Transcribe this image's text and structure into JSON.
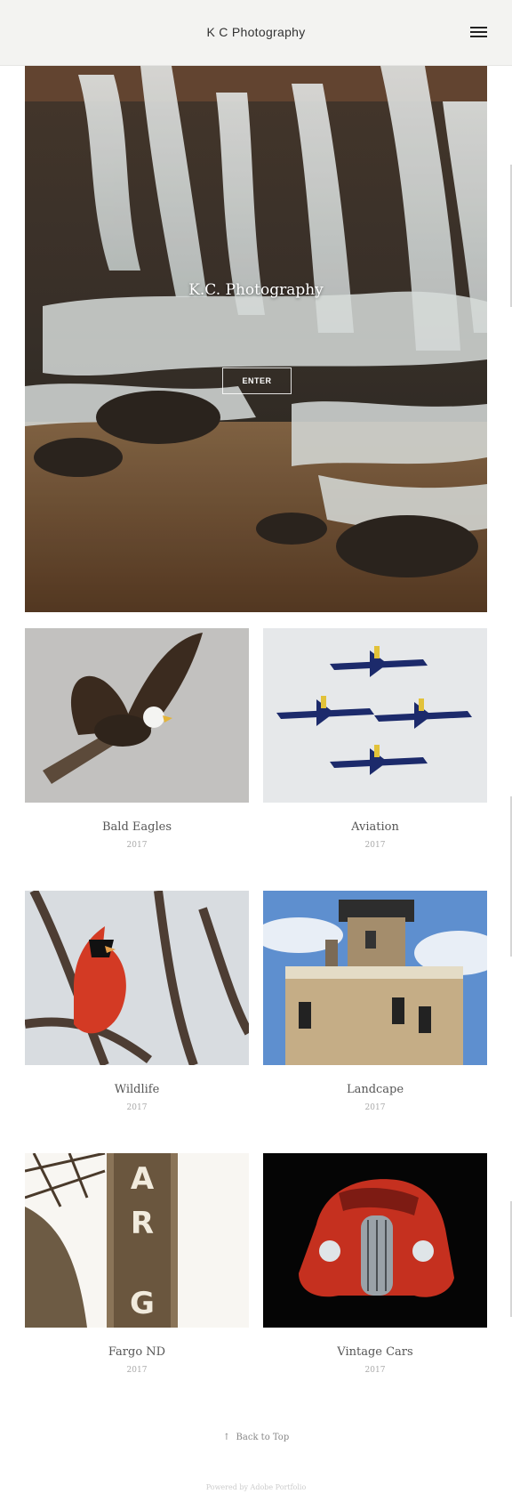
{
  "header": {
    "site_title": "K C Photography"
  },
  "hero": {
    "title": "K.C. Photography",
    "enter_label": "ENTER"
  },
  "projects": [
    {
      "title": "Bald Eagles",
      "year": "2017"
    },
    {
      "title": "Aviation",
      "year": "2017"
    },
    {
      "title": "Wildlife",
      "year": "2017"
    },
    {
      "title": "Landcape",
      "year": "2017"
    },
    {
      "title": "Fargo ND",
      "year": "2017"
    },
    {
      "title": "Vintage Cars",
      "year": "2017"
    }
  ],
  "footer": {
    "back_to_top": "Back to Top",
    "back_arrow": "↑",
    "powered_by": "Powered by Adobe Portfolio"
  },
  "icons": {
    "menu": "hamburger-icon",
    "back": "up-arrow-icon"
  },
  "colors": {
    "header_bg": "#f3f3f1",
    "text": "#333333",
    "muted": "#aaaaaa"
  }
}
